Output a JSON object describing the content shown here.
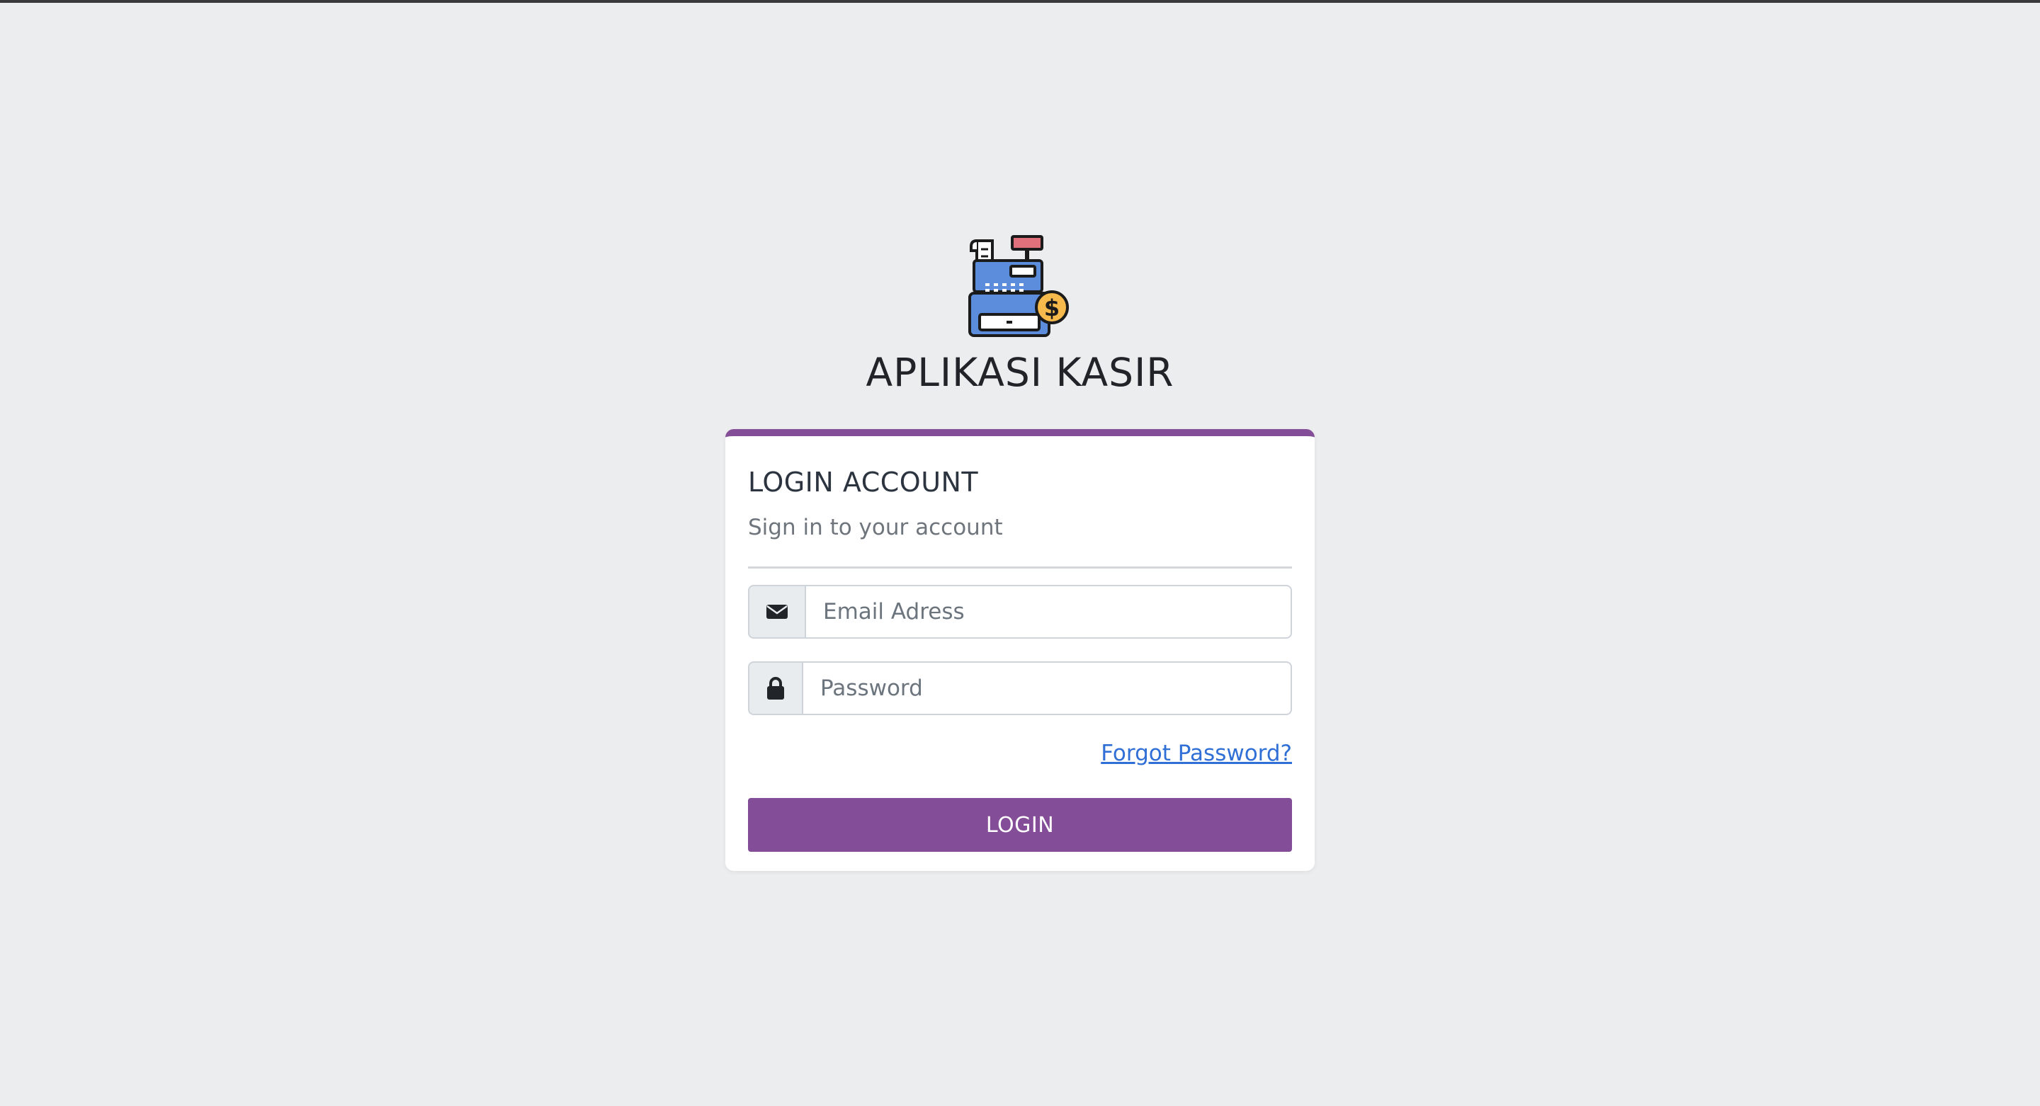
{
  "app": {
    "title": "APLIKASI KASIR",
    "logo": "cash-register-icon"
  },
  "login_card": {
    "title": "LOGIN ACCOUNT",
    "subtitle": "Sign in to your account",
    "email": {
      "icon": "envelope-icon",
      "placeholder": "Email Adress",
      "value": ""
    },
    "password": {
      "icon": "lock-icon",
      "placeholder": "Password",
      "value": ""
    },
    "forgot_label": "Forgot Password?",
    "login_label": "LOGIN"
  },
  "colors": {
    "accent": "#844d97",
    "link": "#2f6fd6",
    "background": "#ecedef"
  }
}
